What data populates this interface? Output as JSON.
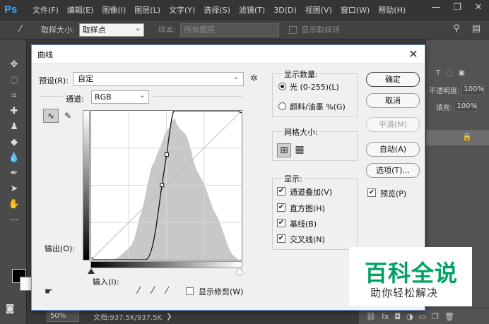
{
  "app": {
    "logo": "Ps",
    "menu": [
      "文件(F)",
      "编辑(E)",
      "图像(I)",
      "图层(L)",
      "文字(Y)",
      "选择(S)",
      "滤镜(T)",
      "3D(D)",
      "视图(V)",
      "窗口(W)",
      "帮助(H)"
    ],
    "window_controls": [
      "—",
      "❐",
      "✕"
    ]
  },
  "options_bar": {
    "sample_size_label": "取样大小:",
    "sample_size_value": "取样点",
    "sample_label": "样本:",
    "sample_value": "所有图层",
    "show_ring_label": "显示取样环"
  },
  "right_panel": {
    "opacity_label": "不透明度:",
    "opacity_value": "100%",
    "fill_label": "填充:",
    "fill_value": "100%"
  },
  "status": {
    "zoom": "50%",
    "doc": "文档:937.5K/937.5K"
  },
  "dialog": {
    "title": "曲线",
    "preset_label": "预设(R):",
    "preset_value": "自定",
    "channel_label": "通道:",
    "channel_value": "RGB",
    "output_label": "输出(O):",
    "input_label": "输入(I):",
    "show_clipping_label": "显示修剪(W)",
    "display_amount": {
      "title": "显示数量:",
      "light_label": "光 (0-255)(L)",
      "pigment_label": "颜料/油墨 %(G)",
      "selected": "light"
    },
    "grid_size": {
      "title": "网格大小:"
    },
    "show": {
      "title": "显示:",
      "items": [
        {
          "label": "通道叠加(V)",
          "checked": true
        },
        {
          "label": "直方图(H)",
          "checked": true
        },
        {
          "label": "基线(B)",
          "checked": true
        },
        {
          "label": "交叉线(N)",
          "checked": true
        }
      ]
    },
    "buttons": {
      "ok": "确定",
      "cancel": "取消",
      "smooth": "平滑(M)",
      "auto": "自动(A)",
      "options": "选项(T)..."
    },
    "preview_label": "预览(P)",
    "preview_checked": true,
    "curve_points": [
      [
        0,
        0
      ],
      [
        92,
        0
      ],
      [
        120,
        128
      ],
      [
        128,
        180
      ],
      [
        140,
        255
      ],
      [
        255,
        255
      ]
    ],
    "histogram": [
      0,
      0,
      0,
      0,
      0,
      0,
      0,
      0,
      0,
      0,
      0,
      0,
      0,
      0,
      0,
      0,
      0,
      0,
      0,
      0,
      2,
      3,
      4,
      5,
      7,
      9,
      10,
      12,
      14,
      16,
      18,
      20,
      22,
      24,
      28,
      32,
      36,
      44,
      52,
      60,
      70,
      78,
      84,
      90,
      100,
      110,
      120,
      132,
      140,
      150,
      160,
      166,
      170,
      174,
      180,
      186,
      190,
      196,
      200,
      206,
      212,
      218,
      224,
      228,
      230,
      232,
      236,
      240,
      246,
      248,
      250,
      244,
      238,
      236,
      232,
      230,
      228,
      226,
      224,
      222,
      218,
      212,
      206,
      198,
      190,
      180,
      172,
      166,
      160,
      156,
      152,
      148,
      144,
      140,
      136,
      132,
      126,
      120,
      114,
      108,
      102,
      96,
      90,
      86,
      82,
      78,
      74,
      70,
      64,
      58,
      52,
      46,
      40,
      34,
      28,
      22,
      18,
      14,
      10,
      8,
      6,
      4,
      2,
      0,
      0,
      0
    ]
  },
  "watermark": {
    "main": "百科全说",
    "sub": "助你轻松解决"
  },
  "colors": {
    "dialog_border": "#6a9cd9",
    "watermark_green": "#00a263"
  }
}
